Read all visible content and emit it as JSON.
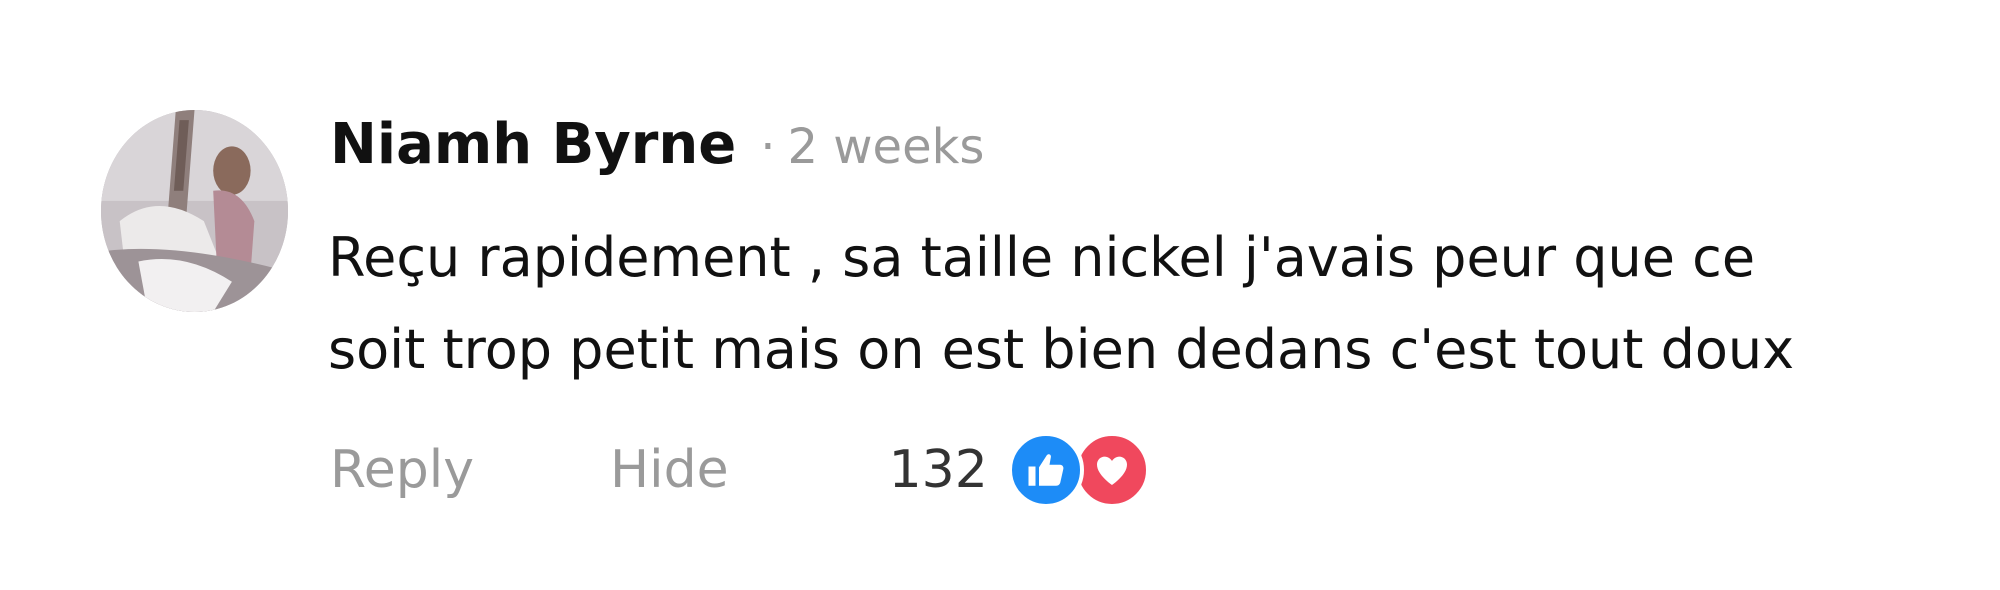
{
  "comment": {
    "author": "Niamh Byrne",
    "separator": "·",
    "time": "2 weeks",
    "text_lines": [
      "Reçu rapidement , sa taille nickel j'avais peur que ce",
      "soit trop petit mais on est bien dedans c'est tout doux"
    ],
    "actions": {
      "reply_label": "Reply",
      "hide_label": "Hide"
    },
    "reaction_count": "132",
    "reactions": [
      "like-icon",
      "love-icon"
    ]
  },
  "colors": {
    "like": "#1d8cf7",
    "love": "#f0485d",
    "muted_text": "#9a9a9a",
    "primary_text": "#111111"
  }
}
